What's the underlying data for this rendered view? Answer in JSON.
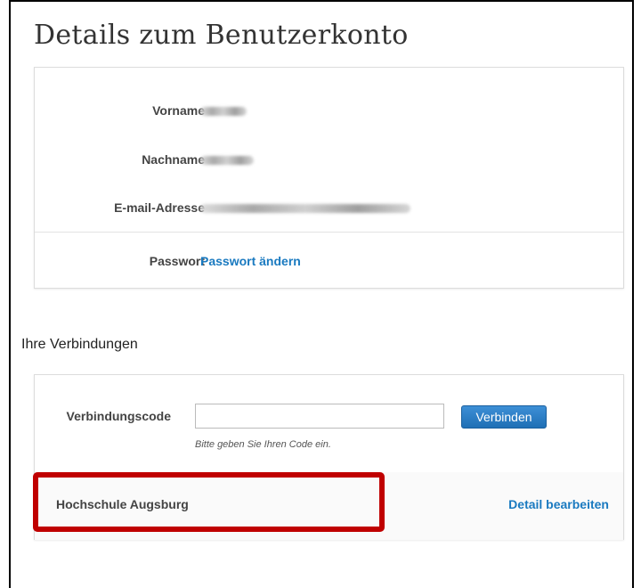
{
  "page": {
    "title": "Details zum Benutzerkonto"
  },
  "account": {
    "fields": [
      {
        "label": "Vorname"
      },
      {
        "label": "Nachname"
      },
      {
        "label": "E-mail-Adresse"
      }
    ],
    "password": {
      "label": "Passwort",
      "link": "Passwort ändern"
    }
  },
  "connections": {
    "title": "Ihre Verbindungen",
    "code_label": "Verbindungscode",
    "code_value": "",
    "connect_button": "Verbinden",
    "hint": "Bitte geben Sie Ihren Code ein.",
    "institution": "Hochschule Augsburg",
    "edit_link": "Detail bearbeiten"
  },
  "colors": {
    "link": "#1a7ac0",
    "button": "#2a7cc7",
    "highlight": "#c00000"
  }
}
